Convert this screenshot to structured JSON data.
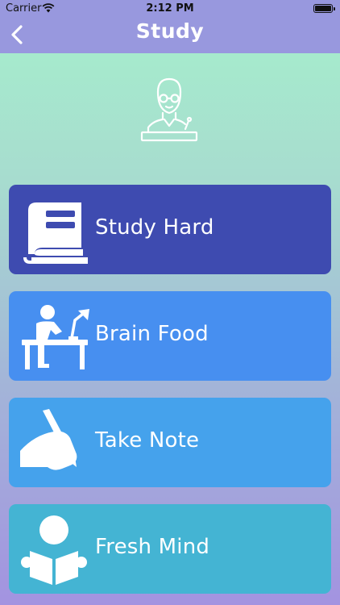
{
  "status_bar": {
    "carrier": "Carrier",
    "time": "2:12 PM"
  },
  "nav": {
    "title": "Study",
    "back_icon": "chevron-left-icon"
  },
  "hero_icon": "teacher-at-podium-icon",
  "colors": {
    "nav_bar": "#9898de",
    "card_study_hard": "#3e4bb0",
    "card_brain_food": "#478ff0",
    "card_take_note": "#45a2ec",
    "card_fresh_mind": "#44b4d3"
  },
  "cards": [
    {
      "label": "Study Hard",
      "icon": "book-icon"
    },
    {
      "label": "Brain Food",
      "icon": "person-at-desk-icon"
    },
    {
      "label": "Take Note",
      "icon": "hand-writing-icon"
    },
    {
      "label": "Fresh Mind",
      "icon": "person-reading-icon"
    }
  ]
}
